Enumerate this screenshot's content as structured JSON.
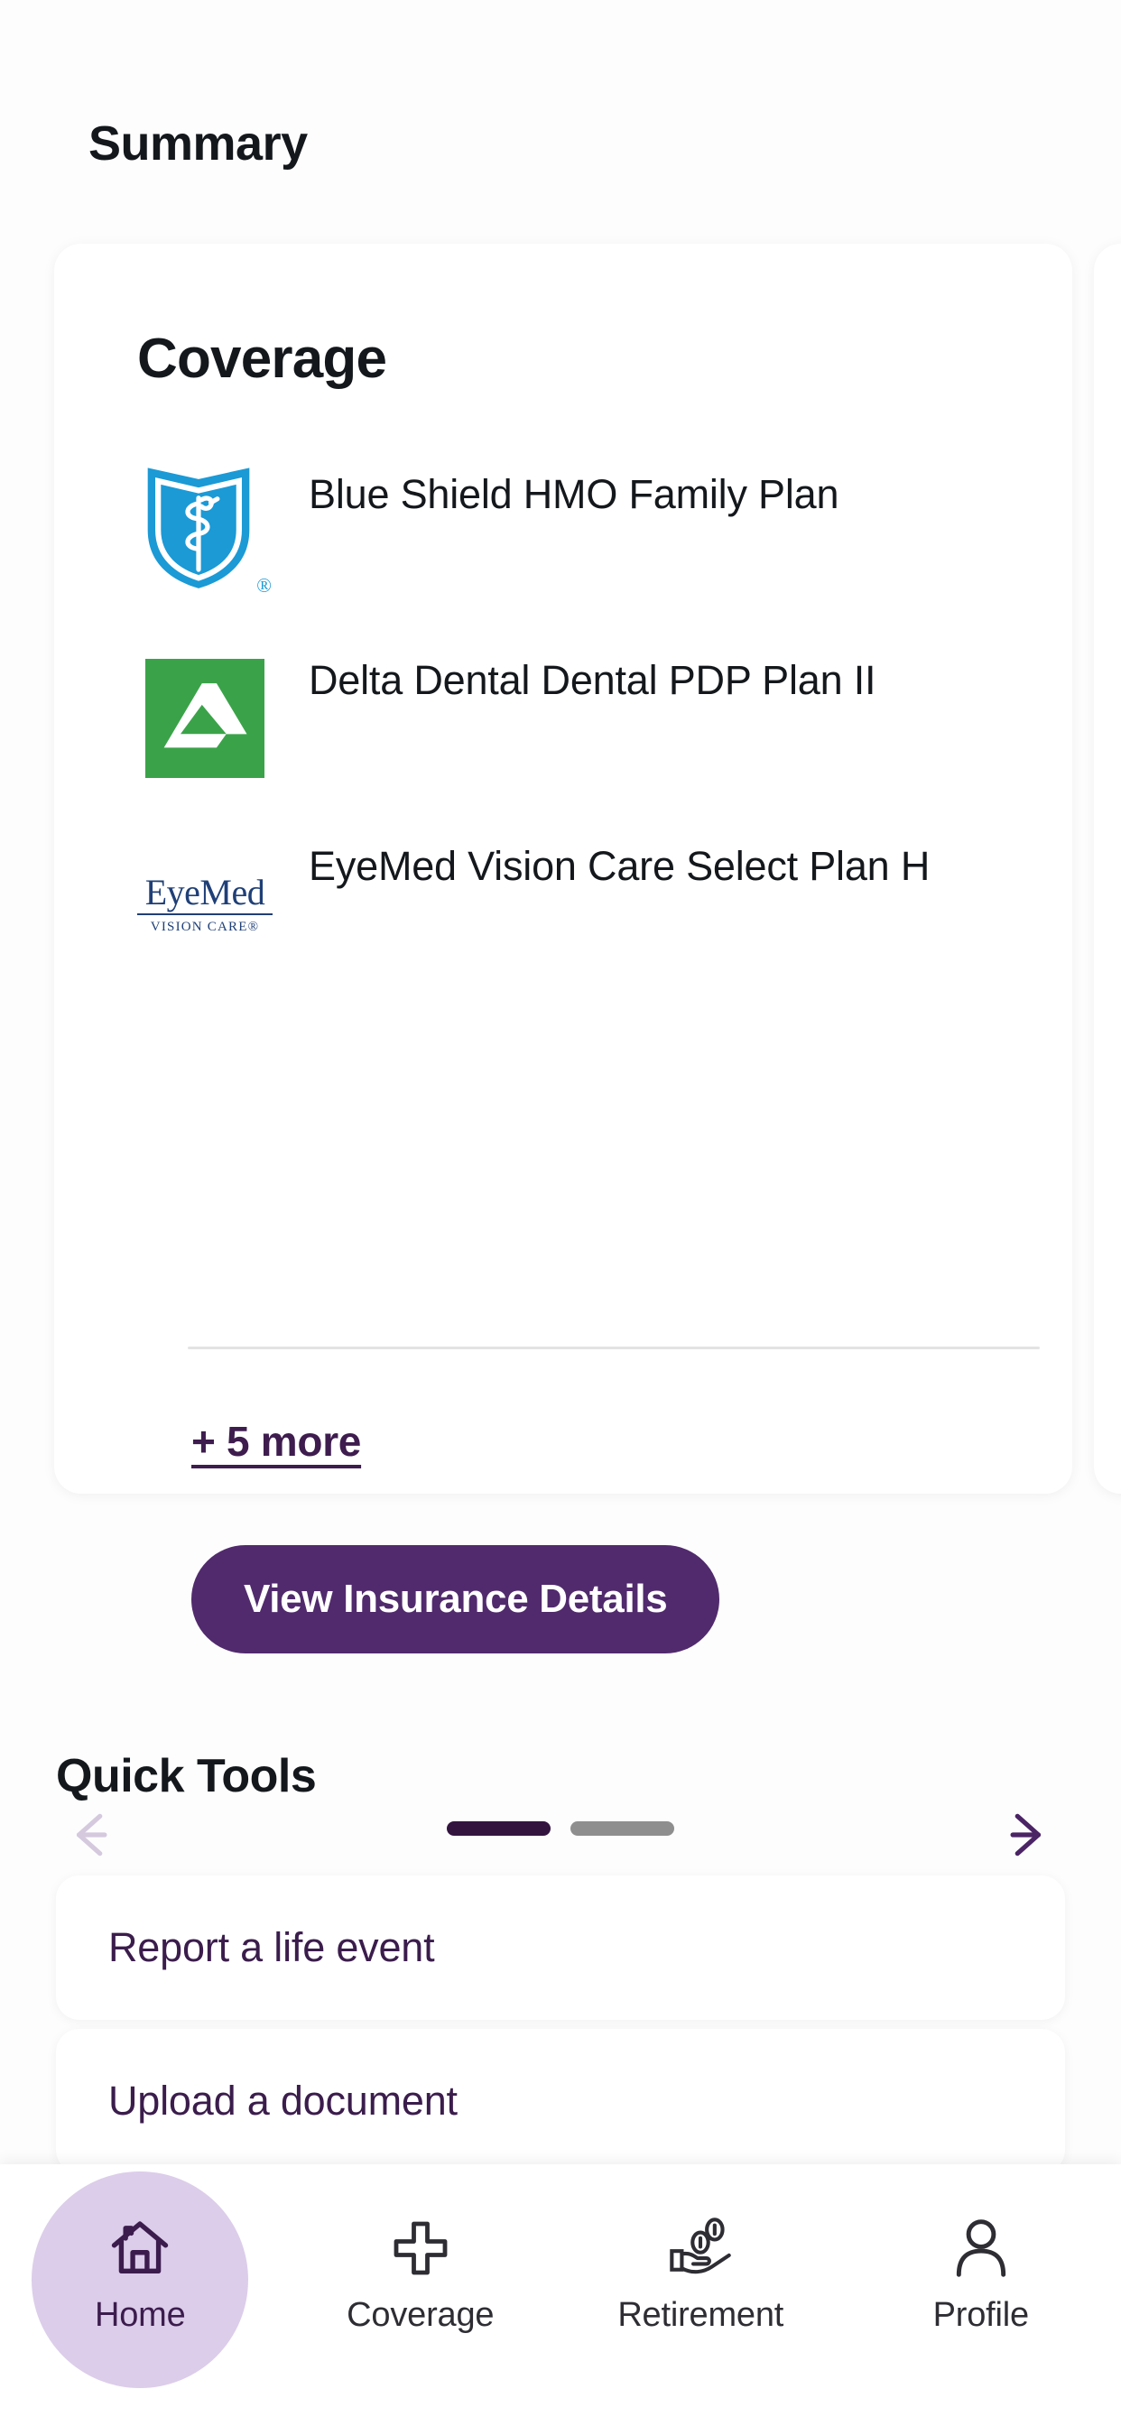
{
  "page": {
    "title": "Summary"
  },
  "carousel": {
    "card": {
      "title": "Coverage",
      "plans": [
        {
          "logo": "blue-shield-logo",
          "name": "Blue Shield HMO Family Plan"
        },
        {
          "logo": "delta-dental-logo",
          "name": "Delta Dental Dental PDP Plan II"
        },
        {
          "logo": "eyemed-logo",
          "name": "EyeMed Vision Care Select Plan H",
          "logo_word": "EyeMed",
          "logo_subtitle": "VISION CARE®"
        }
      ],
      "more_link": "+ 5 more",
      "primary_button": "View Insurance Details"
    },
    "controls": {
      "prev_icon": "arrow-left-icon",
      "next_icon": "arrow-right-icon",
      "slide_count": 2,
      "active_slide": 1
    }
  },
  "quick_tools": {
    "heading": "Quick Tools",
    "items": [
      {
        "label": "Report a life event"
      },
      {
        "label": "Upload a document"
      }
    ]
  },
  "bottom_nav": {
    "items": [
      {
        "label": "Home",
        "icon": "home-icon",
        "active": true
      },
      {
        "label": "Coverage",
        "icon": "plus-cross-icon",
        "active": false
      },
      {
        "label": "Retirement",
        "icon": "hand-coins-icon",
        "active": false
      },
      {
        "label": "Profile",
        "icon": "person-icon",
        "active": false
      }
    ]
  },
  "colors": {
    "brand_purple": "#512a6d",
    "dark_purple": "#33143f",
    "light_purple": "#dccdea",
    "blue_shield_blue": "#1b9ad6",
    "delta_green": "#3aa349",
    "eyemed_navy": "#1f3f77",
    "text_dark": "#14181c",
    "inactive_gray": "#8e8e8e"
  }
}
